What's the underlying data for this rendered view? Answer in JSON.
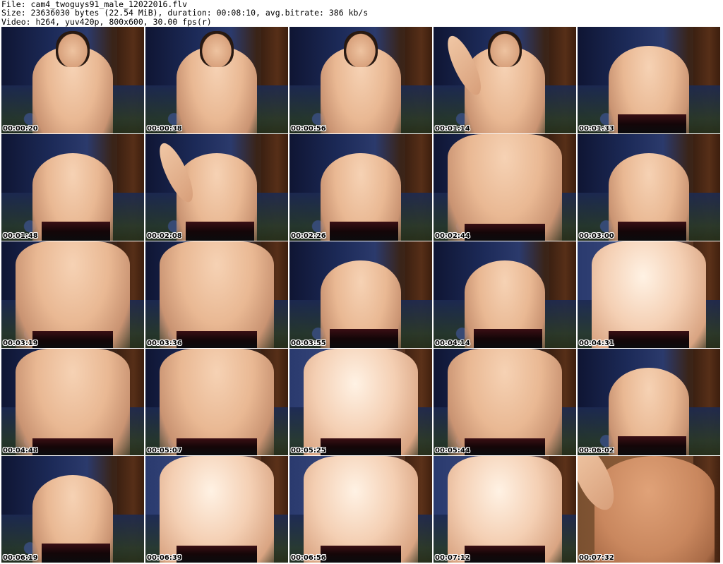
{
  "header": {
    "file_line": "File: cam4_twoguys91_male_12022016.flv",
    "size_line": "Size: 23636030 bytes (22.54 MiB), duration: 00:08:10, avg.bitrate: 386 kb/s",
    "video_line": "Video: h264, yuv420p, 800x600, 30.00 fps(r)"
  },
  "thumbnails": [
    {
      "timestamp": "00:00:20",
      "variant": "portrait"
    },
    {
      "timestamp": "00:00:38",
      "variant": "portrait"
    },
    {
      "timestamp": "00:00:56",
      "variant": "portrait"
    },
    {
      "timestamp": "00:01:14",
      "variant": "portrait-arm"
    },
    {
      "timestamp": "00:01:33",
      "variant": "torso"
    },
    {
      "timestamp": "00:01:48",
      "variant": "torso"
    },
    {
      "timestamp": "00:02:08",
      "variant": "torso-arm"
    },
    {
      "timestamp": "00:02:26",
      "variant": "torso"
    },
    {
      "timestamp": "00:02:44",
      "variant": "close"
    },
    {
      "timestamp": "00:03:00",
      "variant": "torso"
    },
    {
      "timestamp": "00:03:19",
      "variant": "close"
    },
    {
      "timestamp": "00:03:36",
      "variant": "close"
    },
    {
      "timestamp": "00:03:55",
      "variant": "torso"
    },
    {
      "timestamp": "00:04:14",
      "variant": "torso"
    },
    {
      "timestamp": "00:04:31",
      "variant": "close-bright"
    },
    {
      "timestamp": "00:04:48",
      "variant": "close"
    },
    {
      "timestamp": "00:05:07",
      "variant": "close"
    },
    {
      "timestamp": "00:05:25",
      "variant": "close-bright"
    },
    {
      "timestamp": "00:05:44",
      "variant": "close"
    },
    {
      "timestamp": "00:06:02",
      "variant": "torso"
    },
    {
      "timestamp": "00:06:19",
      "variant": "torso"
    },
    {
      "timestamp": "00:06:39",
      "variant": "close-bright"
    },
    {
      "timestamp": "00:06:56",
      "variant": "close-bright"
    },
    {
      "timestamp": "00:07:12",
      "variant": "close-bright"
    },
    {
      "timestamp": "00:07:32",
      "variant": "warm"
    }
  ]
}
